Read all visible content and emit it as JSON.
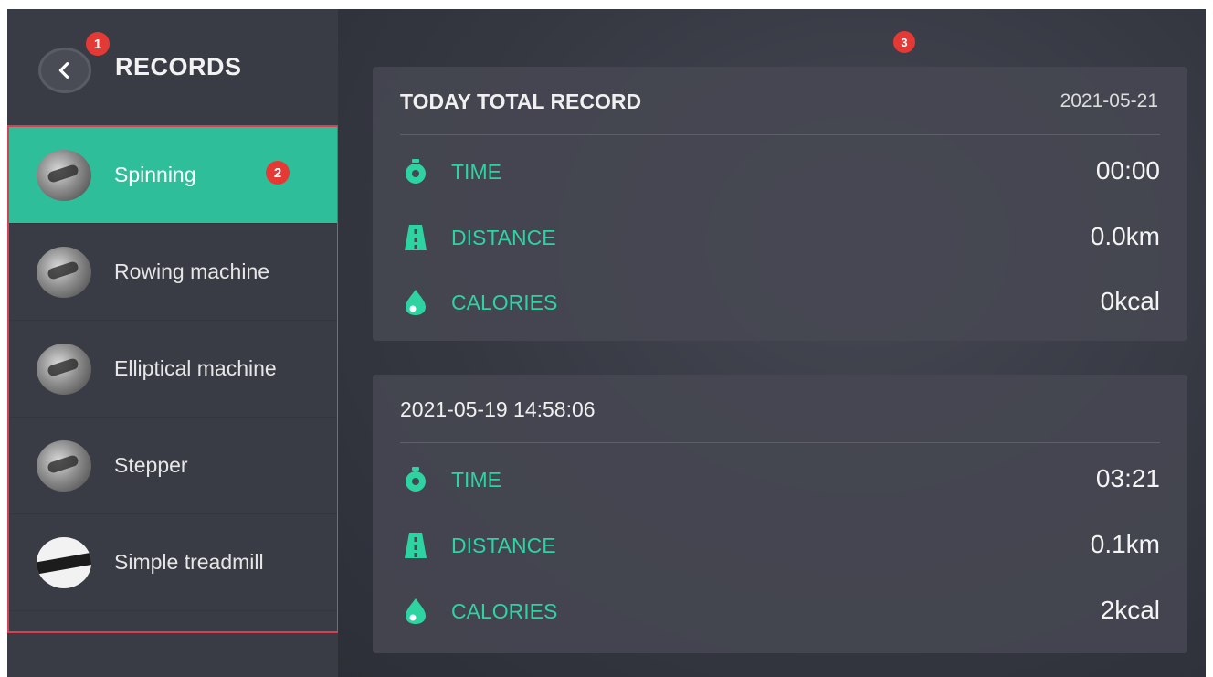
{
  "header": {
    "title": "RECORDS",
    "back_icon": "chevron-left-icon"
  },
  "markers": [
    "1",
    "2",
    "3"
  ],
  "categories": [
    {
      "label": "Spinning",
      "icon": "spinning-bike-thumbnail",
      "active": true
    },
    {
      "label": "Rowing machine",
      "icon": "rowing-machine-thumbnail",
      "active": false
    },
    {
      "label": "Elliptical machine",
      "icon": "elliptical-machine-thumbnail",
      "active": false
    },
    {
      "label": "Stepper",
      "icon": "stepper-thumbnail",
      "active": false
    },
    {
      "label": "Simple treadmill",
      "icon": "treadmill-thumbnail",
      "active": false
    }
  ],
  "records": [
    {
      "title": "TODAY TOTAL RECORD",
      "date": "2021-05-21",
      "stats": [
        {
          "label": "TIME",
          "value": "00:00",
          "icon": "stopwatch-icon"
        },
        {
          "label": "DISTANCE",
          "value": "0.0km",
          "icon": "road-icon"
        },
        {
          "label": "CALORIES",
          "value": "0kcal",
          "icon": "flame-icon"
        }
      ]
    },
    {
      "title": "2021-05-19 14:58:06",
      "date": "",
      "stats": [
        {
          "label": "TIME",
          "value": "03:21",
          "icon": "stopwatch-icon"
        },
        {
          "label": "DISTANCE",
          "value": "0.1km",
          "icon": "road-icon"
        },
        {
          "label": "CALORIES",
          "value": "2kcal",
          "icon": "flame-icon"
        }
      ]
    }
  ],
  "colors": {
    "accent": "#2ebf9a",
    "stat_label": "#2ed3a2",
    "sidebar_bg": "#3a3c45",
    "main_bg": "#353741",
    "marker": "#e53935",
    "highlight_border": "#d64050"
  }
}
